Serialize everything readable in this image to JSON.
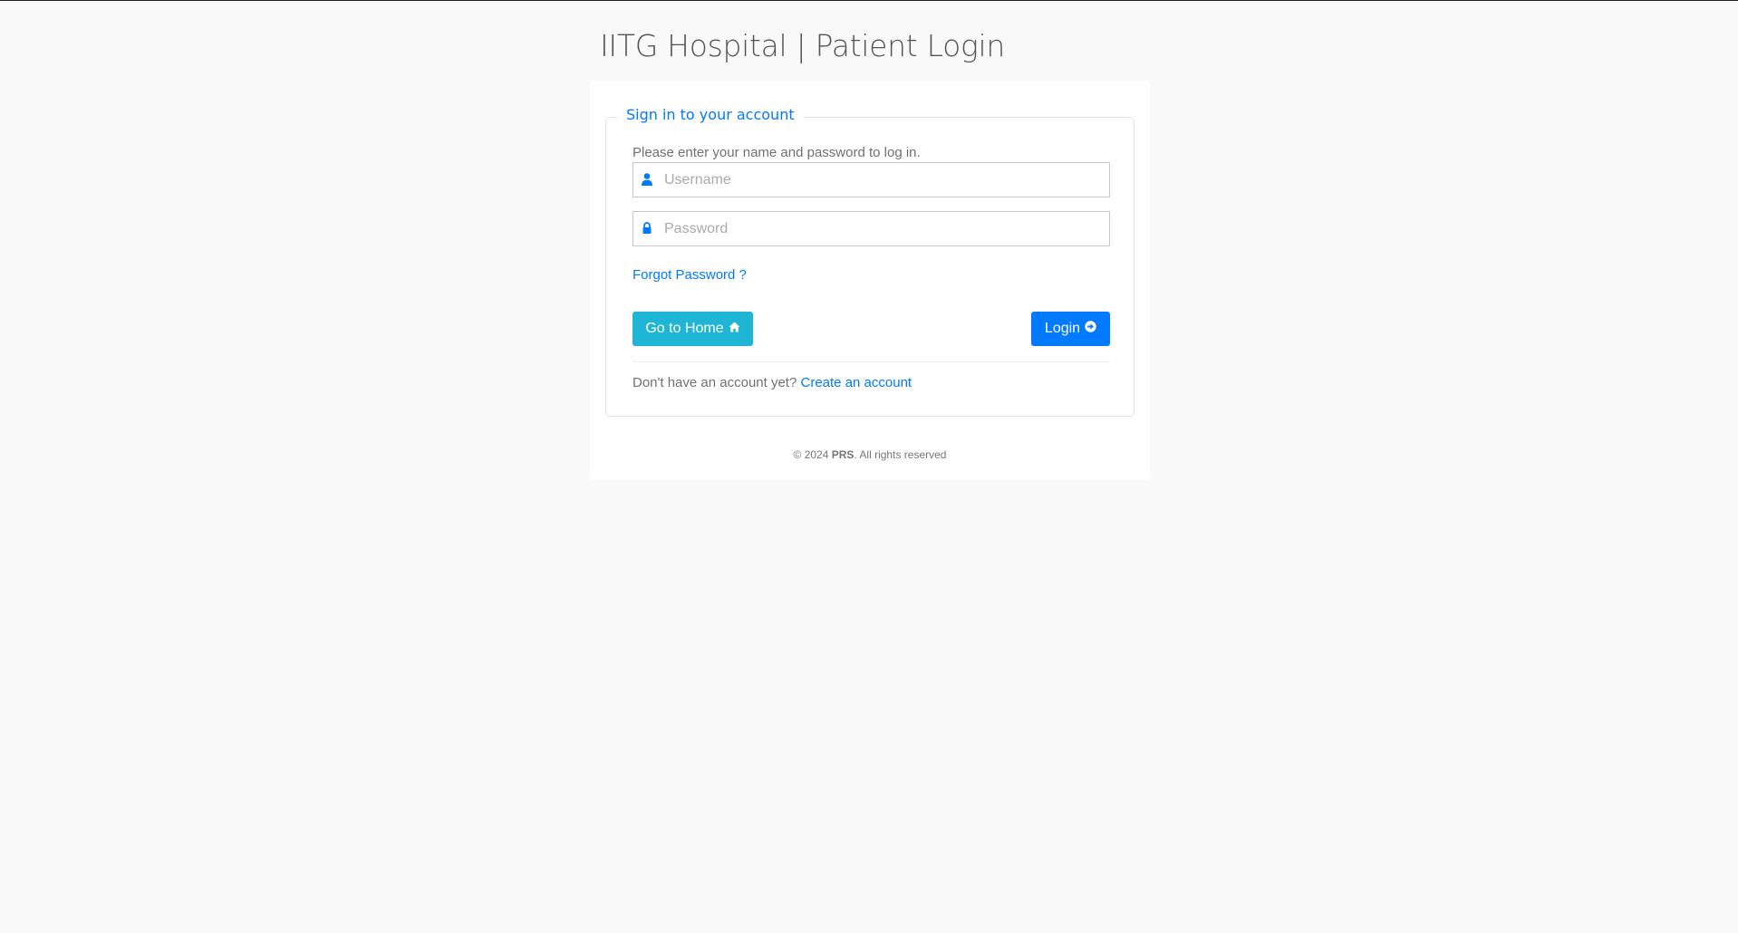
{
  "page": {
    "title": "IITG Hospital | Patient Login"
  },
  "form": {
    "legend": "Sign in to your account",
    "intro": "Please enter your name and password to log in.",
    "username": {
      "placeholder": "Username",
      "value": "",
      "icon": "user-icon"
    },
    "password": {
      "placeholder": "Password",
      "value": "",
      "icon": "lock-icon"
    },
    "forgot_label": "Forgot Password ?",
    "home_button": {
      "label": "Go to Home",
      "icon": "home-icon",
      "color": "#1fb5d5"
    },
    "login_button": {
      "label": "Login",
      "icon": "arrow-circle-right-icon",
      "color": "#007aff"
    },
    "signup_prompt": "Don't have an account yet?",
    "signup_link": "Create an account"
  },
  "footer": {
    "copyright_prefix": "© 2024",
    "brand": "PRS",
    "copyright_suffix": ". All rights reserved"
  },
  "colors": {
    "accent": "#007aff",
    "info": "#1fb5d5",
    "background": "#f9f9f9"
  }
}
